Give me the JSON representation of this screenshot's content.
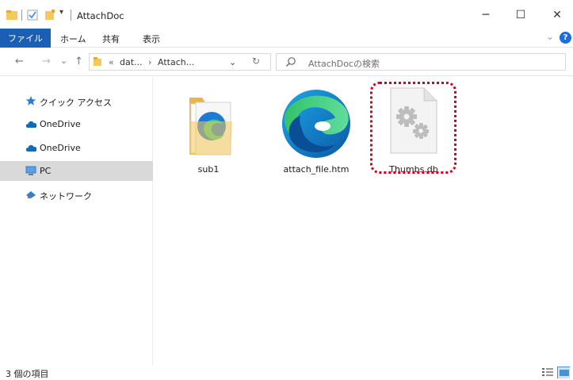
{
  "window": {
    "title": "AttachDoc",
    "minimize_glyph": "─",
    "maximize_glyph": "☐",
    "close_glyph": "✕"
  },
  "ribbon": {
    "tabs": [
      {
        "label": "ファイル"
      },
      {
        "label": "ホーム"
      },
      {
        "label": "共有"
      },
      {
        "label": "表示"
      }
    ],
    "help_glyph": "?"
  },
  "address": {
    "back_glyph": "←",
    "forward_glyph": "→",
    "history_glyph": "⌄",
    "up_glyph": "↑",
    "overflow": "«",
    "crumbs": [
      "dat...",
      "Attach..."
    ],
    "separator": "›",
    "dropdown_glyph": "⌄",
    "refresh_glyph": "↻"
  },
  "search": {
    "placeholder": "AttachDocの検索"
  },
  "nav": {
    "items": [
      {
        "label": "クイック アクセス",
        "icon": "star-icon"
      },
      {
        "label": "OneDrive",
        "icon": "cloud-icon"
      },
      {
        "label": "OneDrive",
        "icon": "cloud-icon"
      },
      {
        "label": "PC",
        "icon": "pc-icon"
      },
      {
        "label": "ネットワーク",
        "icon": "network-icon"
      }
    ]
  },
  "files": [
    {
      "name": "sub1",
      "icon": "folder-icon"
    },
    {
      "name": "attach_file.htm",
      "icon": "edge-icon"
    },
    {
      "name": "Thumbs.db",
      "icon": "system-file-icon"
    }
  ],
  "status": {
    "item_count": "3 個の項目"
  },
  "colors": {
    "accent": "#1a5fb4",
    "highlight": "#d0021b",
    "selected_bg": "#d9d9d9",
    "folder": "#f4c85a"
  }
}
